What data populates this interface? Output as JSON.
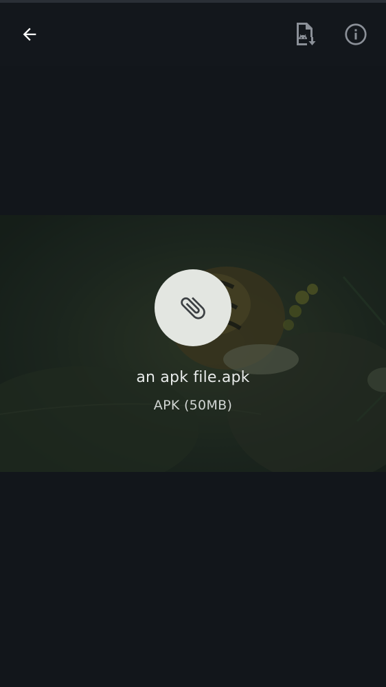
{
  "toolbar": {
    "back_icon": "arrow-left-icon",
    "download_icon": "apk-document-download-icon",
    "info_icon": "info-outline-icon"
  },
  "preview": {
    "attachment_icon": "paperclip-icon",
    "file_name": "an apk file.apk",
    "file_meta": "APK (50MB)"
  },
  "colors": {
    "background": "#12161b",
    "icon": "#ffffff",
    "icon_muted": "#8b9098",
    "circle": "#e3e6e1"
  }
}
